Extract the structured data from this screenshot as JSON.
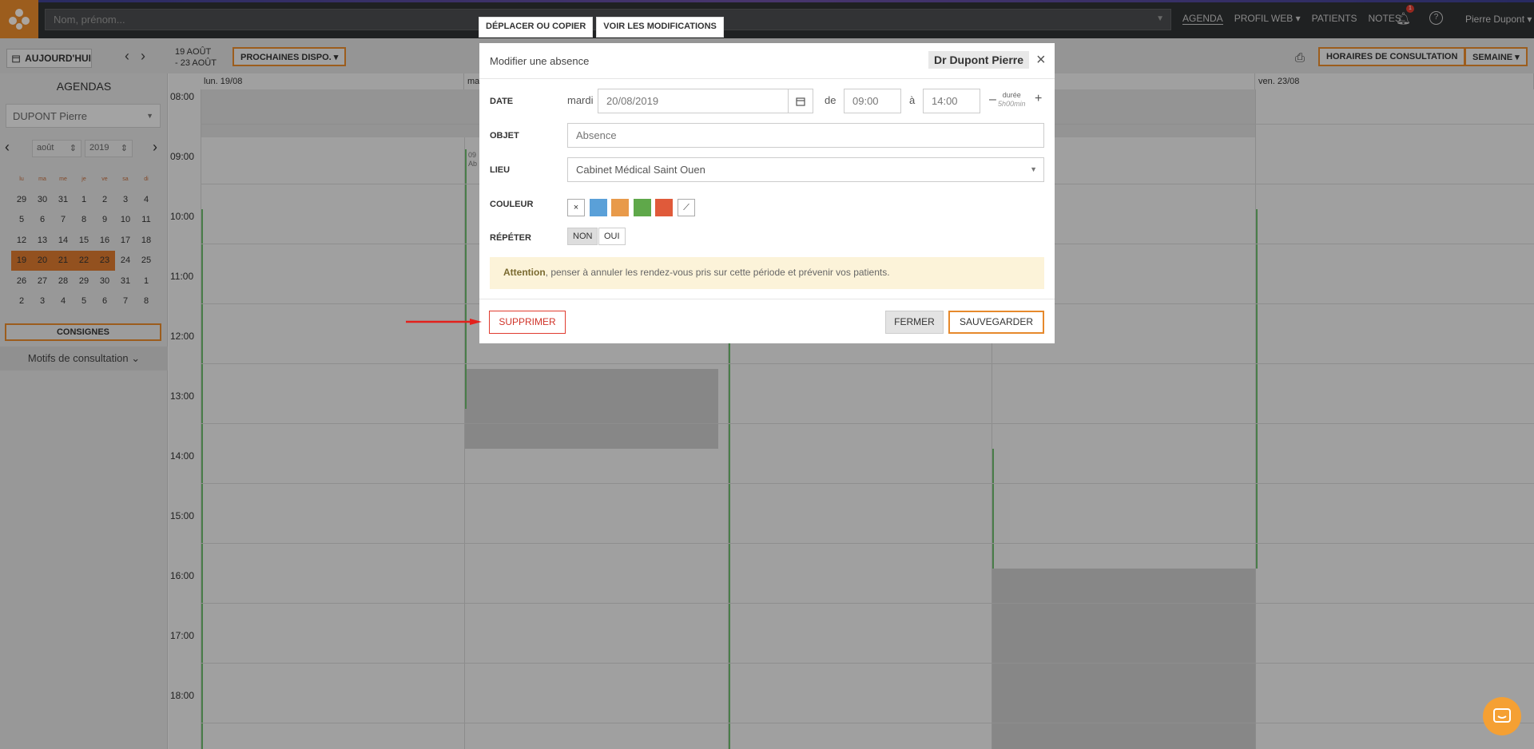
{
  "topbar": {
    "search_placeholder": "Nom, prénom...",
    "nav": [
      "AGENDA",
      "PROFIL WEB ▾",
      "PATIENTS",
      "NOTES"
    ],
    "notification_count": "1",
    "help": "?",
    "user": "Pierre Dupont ▾"
  },
  "toolbar": {
    "today": "AUJOURD'HUI",
    "range_line1": "19 AOÛT",
    "range_line2": "- 23 AOÛT",
    "next_dispo": "PROCHAINES DISPO. ▾",
    "hours": "HORAIRES DE CONSULTATION",
    "week": "SEMAINE ▾"
  },
  "sidebar": {
    "title": "AGENDAS",
    "agenda_select": "DUPONT Pierre",
    "month": "août",
    "year": "2019",
    "weekdays": [
      "lu",
      "ma",
      "me",
      "je",
      "ve",
      "sa",
      "di"
    ],
    "weeks": [
      [
        "29",
        "30",
        "31",
        "1",
        "2",
        "3",
        "4"
      ],
      [
        "5",
        "6",
        "7",
        "8",
        "9",
        "10",
        "11"
      ],
      [
        "12",
        "13",
        "14",
        "15",
        "16",
        "17",
        "18"
      ],
      [
        "19",
        "20",
        "21",
        "22",
        "23",
        "24",
        "25"
      ],
      [
        "26",
        "27",
        "28",
        "29",
        "30",
        "31",
        "1"
      ],
      [
        "2",
        "3",
        "4",
        "5",
        "6",
        "7",
        "8"
      ]
    ],
    "consignes": "CONSIGNES",
    "motifs": "Motifs de consultation"
  },
  "calendar": {
    "days": [
      "lun. 19/08",
      "ma",
      "",
      "",
      "ven. 23/08"
    ],
    "hours": [
      "08:00",
      "09:00",
      "10:00",
      "11:00",
      "12:00",
      "13:00",
      "14:00",
      "15:00",
      "16:00",
      "17:00",
      "18:00"
    ],
    "event_time": "09",
    "event_text": "Ab"
  },
  "modal": {
    "tab_move": "DÉPLACER OU COPIER",
    "tab_changes": "VOIR LES MODIFICATIONS",
    "title": "Modifier une absence",
    "doctor": "Dr Dupont Pierre",
    "date_label": "DATE",
    "weekday": "mardi",
    "date_value": "20/08/2019",
    "from_label": "de",
    "from_time": "09:00",
    "to_label": "à",
    "to_time": "14:00",
    "duration_label": "durée",
    "duration_value": "5h00min",
    "object_label": "OBJET",
    "object_placeholder": "Absence",
    "place_label": "LIEU",
    "place_value": "Cabinet Médical Saint Ouen",
    "color_label": "COULEUR",
    "colors": [
      "#5aa0d8",
      "#e89a4a",
      "#5fa84a",
      "#e05a3a"
    ],
    "repeat_label": "RÉPÉTER",
    "repeat_no": "NON",
    "repeat_yes": "OUI",
    "warning_bold": "Attention",
    "warning_text": ", penser à annuler les rendez-vous pris sur cette période et prévenir vos patients.",
    "delete": "SUPPRIMER",
    "close": "FERMER",
    "save": "SAUVEGARDER"
  }
}
